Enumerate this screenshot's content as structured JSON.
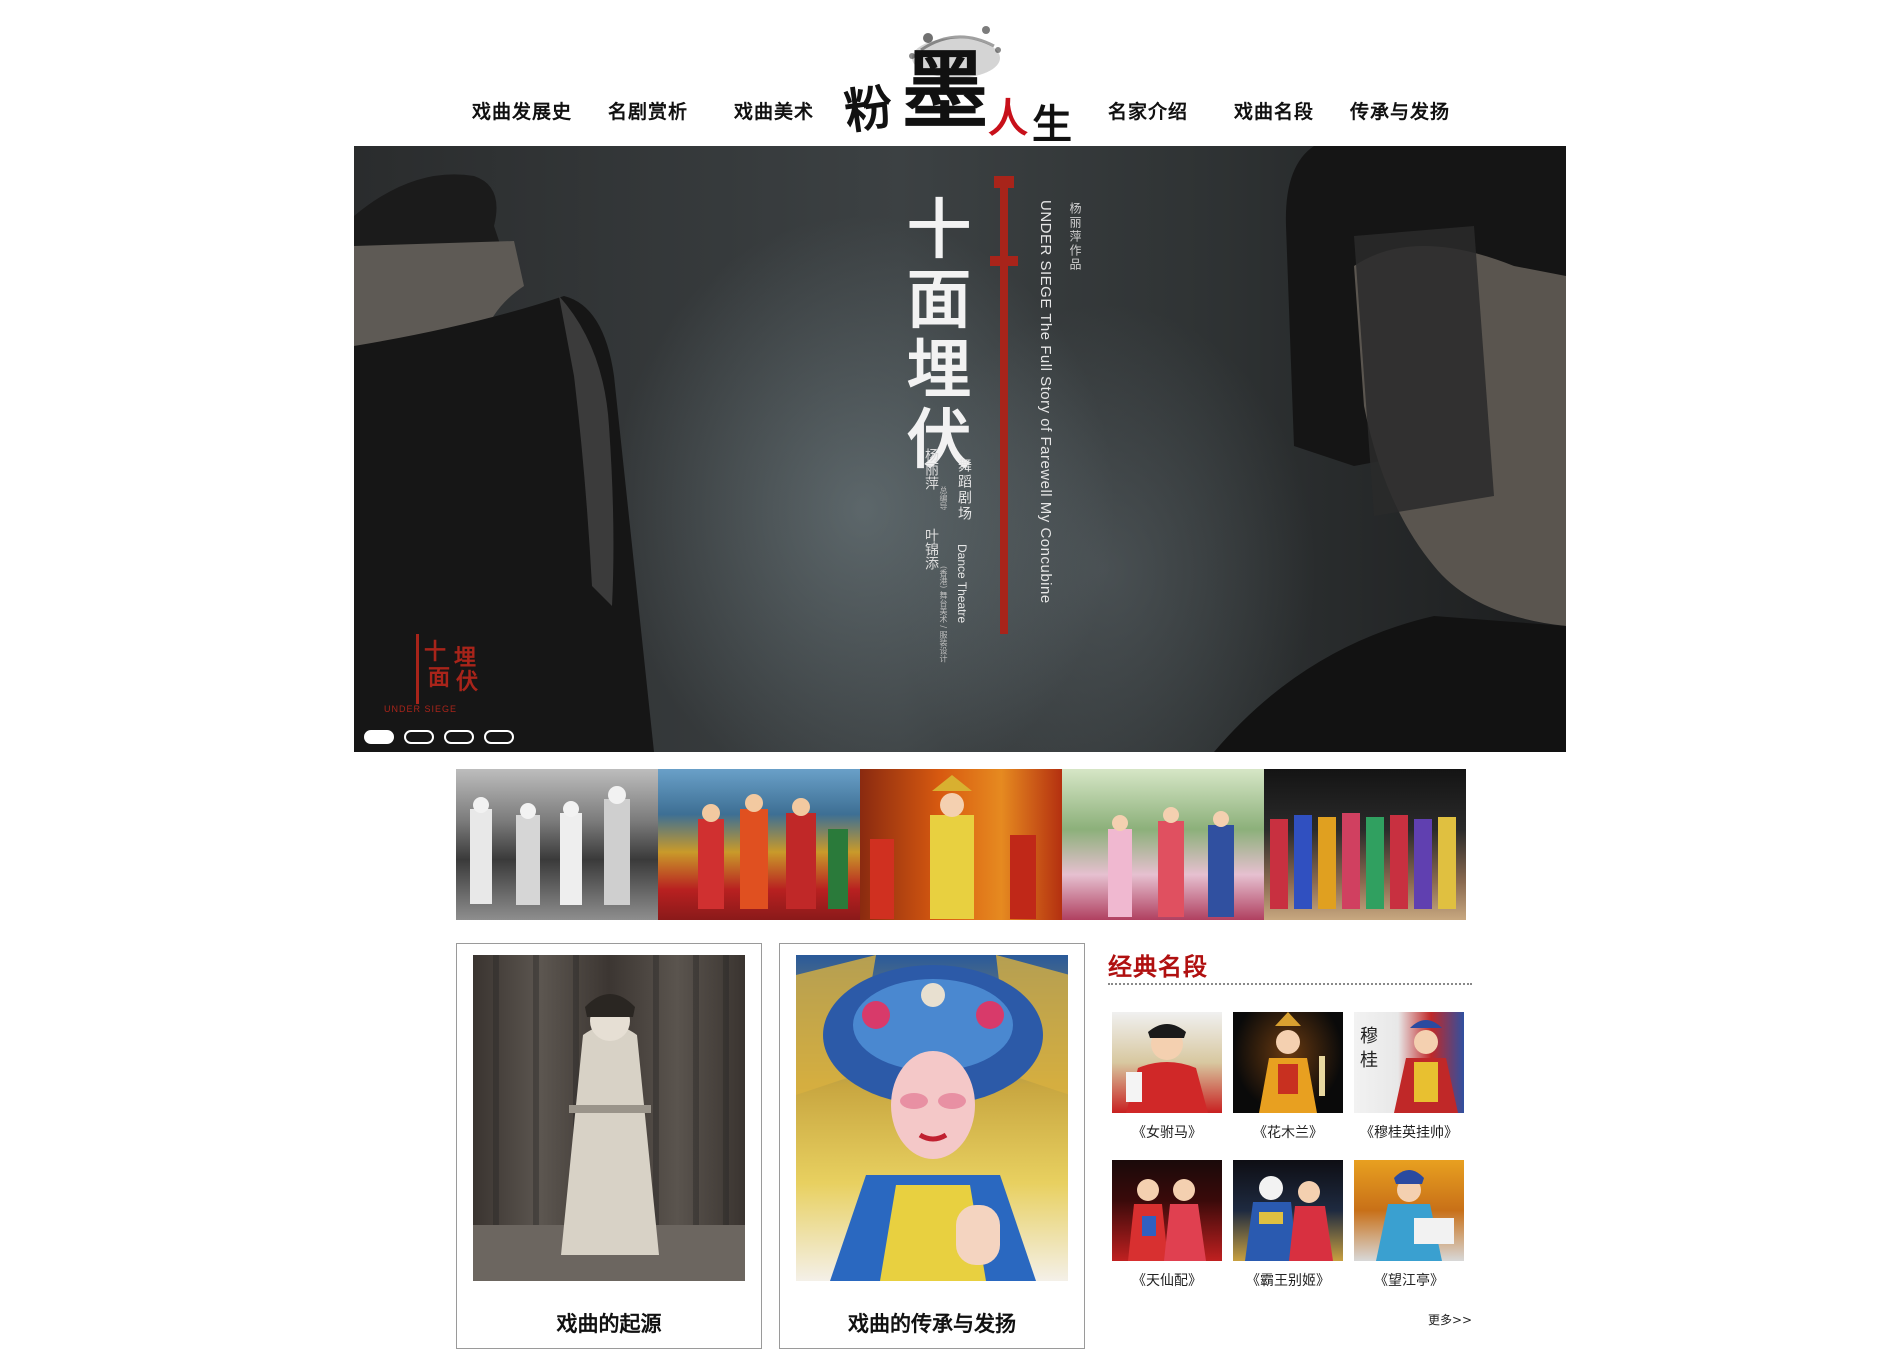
{
  "header": {
    "nav_left": [
      "戏曲发展史",
      "名剧赏析",
      "戏曲美术"
    ],
    "nav_right": [
      "名家介绍",
      "戏曲名段",
      "传承与发扬"
    ],
    "logo": {
      "chars": [
        "粉",
        "墨",
        "人",
        "生"
      ],
      "accent_color": "#c8101a"
    }
  },
  "banner": {
    "title_chars": [
      "十",
      "面",
      "埋",
      "伏"
    ],
    "english_vertical": "UNDER SIEGE  The Full Story of Farewell My Concubine",
    "credit_top": "杨丽萍作品",
    "subtitle": "舞蹈剧场",
    "subtitle_en": "Dance Theatre",
    "name_a": "杨丽萍",
    "name_a_role": "总编导",
    "name_b": "叶锦添",
    "name_b_role": "(香港) 舞台美术 / 服装设计",
    "corner_logo_chars": [
      "十",
      "面",
      "埋",
      "伏"
    ],
    "corner_en": "UNDER SIEGE",
    "slide_count": 4,
    "active_slide": 1,
    "accent_color": "#a8241a"
  },
  "features": [
    {
      "caption": "戏曲的起源",
      "icon": "sepia-actress-photo"
    },
    {
      "caption": "戏曲的传承与发扬",
      "icon": "opera-headdress-photo"
    }
  ],
  "classics": {
    "title": "经典名段",
    "items": [
      "《女驸马》",
      "《花木兰》",
      "《穆桂英挂帅》",
      "《天仙配》",
      "《霸王别姬》",
      "《望江亭》"
    ],
    "more_label": "更多>>"
  }
}
